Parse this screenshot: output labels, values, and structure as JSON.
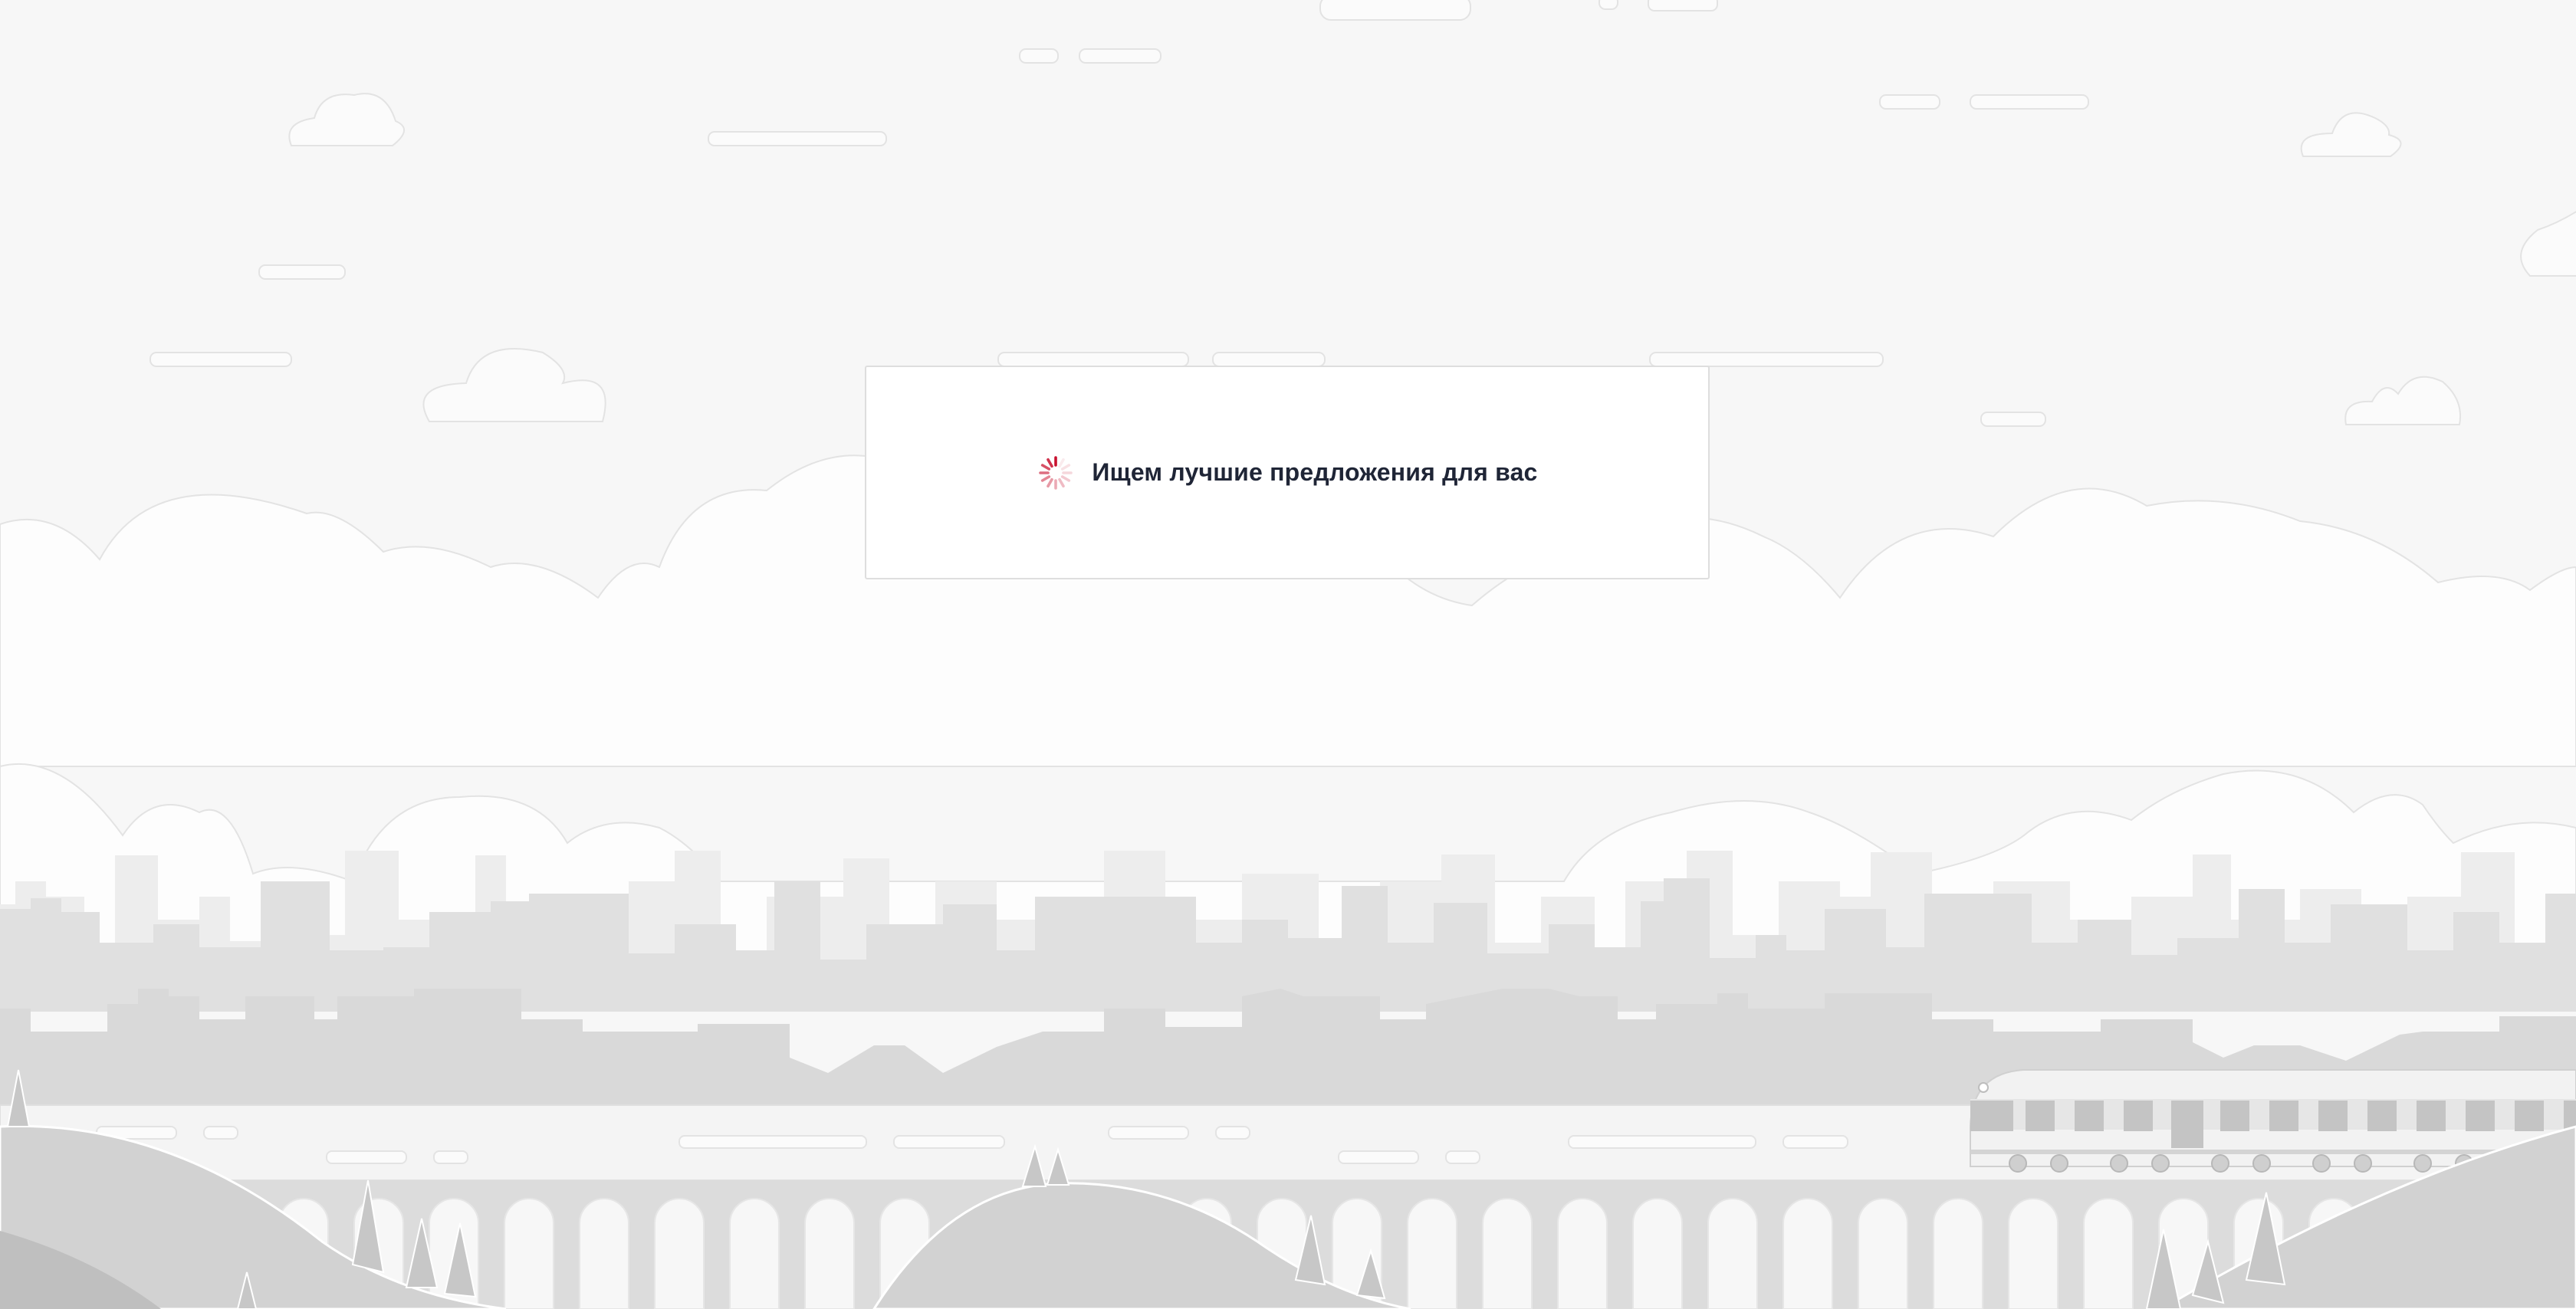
{
  "loader": {
    "message": "Ищем лучшие предложения для вас",
    "spinner_icon": "loading-spinner-icon"
  },
  "colors": {
    "sky": "#f7f7f7",
    "card": "#ffffff",
    "text": "#1f2536",
    "spinner": "#c8102e"
  }
}
